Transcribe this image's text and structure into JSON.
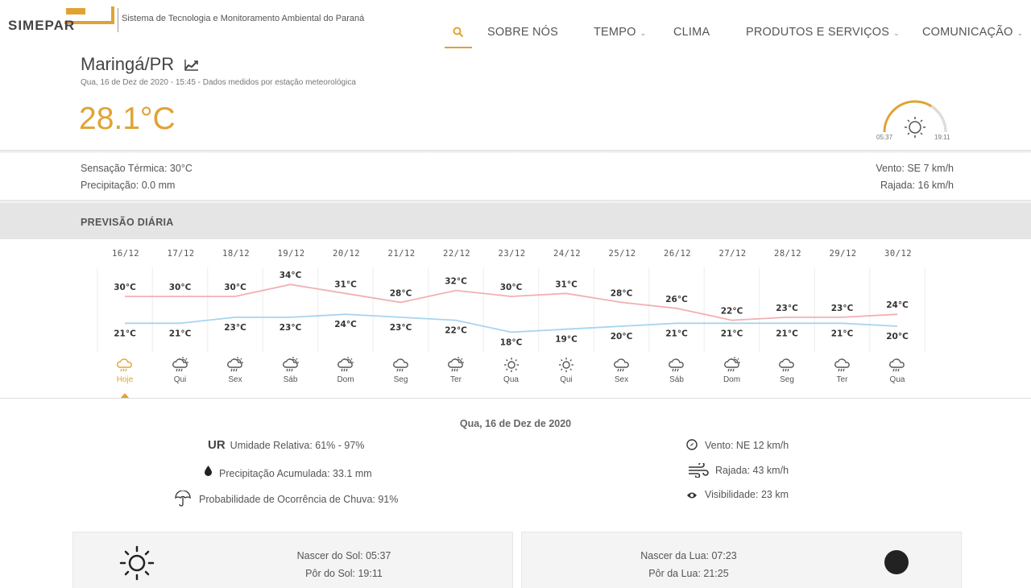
{
  "header": {
    "logo_text": "SIMEPAR",
    "tagline": "Sistema de Tecnologia e Monitoramento Ambiental do Paraná",
    "nav": [
      "SOBRE NÓS",
      "TEMPO",
      "CLIMA",
      "PRODUTOS E SERVIÇOS",
      "COMUNICAÇÃO"
    ]
  },
  "current": {
    "city": "Maringá/PR",
    "measured": "Qua, 16 de Dez de 2020 - 15:45 - Dados medidos por estação meteorológica",
    "temperature": "28.1°C",
    "sunrise": "05:37",
    "sunset": "19:11",
    "feels_like": "Sensação Térmica: 30°C",
    "precipitation": "Precipitação: 0.0 mm",
    "wind": "Vento: SE 7 km/h",
    "gust": "Rajada: 16 km/h"
  },
  "forecast": {
    "title": "PREVISÃO DIÁRIA",
    "days": [
      {
        "date": "16/12",
        "label": "Hoje",
        "max": "30°C",
        "min": "21°C",
        "icon": "rain-cloud-icon"
      },
      {
        "date": "17/12",
        "label": "Qui",
        "max": "30°C",
        "min": "21°C",
        "icon": "sun-rain-icon"
      },
      {
        "date": "18/12",
        "label": "Sex",
        "max": "30°C",
        "min": "23°C",
        "icon": "sun-rain-icon"
      },
      {
        "date": "19/12",
        "label": "Sáb",
        "max": "34°C",
        "min": "23°C",
        "icon": "sun-rain-icon"
      },
      {
        "date": "20/12",
        "label": "Dom",
        "max": "31°C",
        "min": "24°C",
        "icon": "sun-rain-icon"
      },
      {
        "date": "21/12",
        "label": "Seg",
        "max": "28°C",
        "min": "23°C",
        "icon": "rain-cloud-icon"
      },
      {
        "date": "22/12",
        "label": "Ter",
        "max": "32°C",
        "min": "22°C",
        "icon": "sun-rain-icon"
      },
      {
        "date": "23/12",
        "label": "Qua",
        "max": "30°C",
        "min": "18°C",
        "icon": "sun-icon"
      },
      {
        "date": "24/12",
        "label": "Qui",
        "max": "31°C",
        "min": "19°C",
        "icon": "sun-icon"
      },
      {
        "date": "25/12",
        "label": "Sex",
        "max": "28°C",
        "min": "20°C",
        "icon": "rain-cloud-icon"
      },
      {
        "date": "26/12",
        "label": "Sáb",
        "max": "26°C",
        "min": "21°C",
        "icon": "rain-cloud-icon"
      },
      {
        "date": "27/12",
        "label": "Dom",
        "max": "22°C",
        "min": "21°C",
        "icon": "sun-rain-icon"
      },
      {
        "date": "28/12",
        "label": "Seg",
        "max": "23°C",
        "min": "21°C",
        "icon": "rain-cloud-icon"
      },
      {
        "date": "29/12",
        "label": "Ter",
        "max": "23°C",
        "min": "21°C",
        "icon": "rain-cloud-icon"
      },
      {
        "date": "30/12",
        "label": "Qua",
        "max": "24°C",
        "min": "20°C",
        "icon": "rain-cloud-icon"
      }
    ]
  },
  "chart_data": {
    "type": "line",
    "x": [
      "16/12",
      "17/12",
      "18/12",
      "19/12",
      "20/12",
      "21/12",
      "22/12",
      "23/12",
      "24/12",
      "25/12",
      "26/12",
      "27/12",
      "28/12",
      "29/12",
      "30/12"
    ],
    "series": [
      {
        "values": [
          30,
          30,
          30,
          34,
          31,
          28,
          32,
          30,
          31,
          28,
          26,
          22,
          23,
          23,
          24
        ],
        "color": "#f2b0b0"
      },
      {
        "values": [
          21,
          21,
          23,
          23,
          24,
          23,
          22,
          18,
          19,
          20,
          21,
          21,
          21,
          21,
          20
        ],
        "color": "#a8d4f0"
      }
    ]
  },
  "detail": {
    "title": "Qua, 16 de Dez de 2020",
    "ur_label": "UR",
    "humidity": "Umidade Relativa: 61% - 97%",
    "precip_acc": "Precipitação Acumulada: 33.1 mm",
    "rain_prob": "Probabilidade de Ocorrência de Chuva: 91%",
    "wind": "Vento: NE 12 km/h",
    "gust": "Rajada: 43 km/h",
    "visibility": "Visibilidade: 23 km"
  },
  "sun": {
    "rise": "Nascer do Sol: 05:37",
    "set": "Pôr do Sol: 19:11"
  },
  "moon": {
    "rise": "Nascer da Lua: 07:23",
    "set": "Pôr da Lua: 21:25"
  },
  "colors": {
    "accent": "#e0a333",
    "max_line": "#f2b0b0",
    "min_line": "#a8d4f0"
  }
}
